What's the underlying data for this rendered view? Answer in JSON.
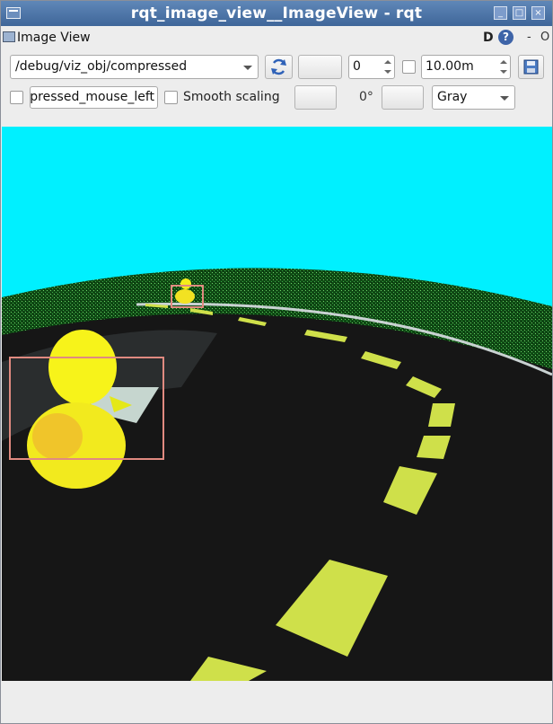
{
  "window": {
    "title": "rqt_image_view__ImageView - rqt",
    "icon": "app-window-icon",
    "buttons": [
      "_",
      "□",
      "×"
    ]
  },
  "plugin": {
    "title": "Image View",
    "d_label": "D",
    "help_label": "?",
    "minimize_label": "-",
    "close_label": "O"
  },
  "toolbar": {
    "topic": "/debug/viz_obj/compressed",
    "refresh_icon": "refresh-icon",
    "zoom_value": "0",
    "rate_value": "10.00m",
    "save_icon": "save-icon",
    "mouse_topic": "pressed_mouse_left",
    "smooth_scaling_label": "Smooth scaling",
    "rotation_label": "0°",
    "color_scheme": "Gray"
  },
  "image": {
    "sky_color": "#00f0ff",
    "road_color": "#141414",
    "grass_color": "#0f4a14",
    "lane_color": "#cfe04a",
    "duck_color": "#f4ee1a",
    "bbox_color": "#e08a80"
  }
}
